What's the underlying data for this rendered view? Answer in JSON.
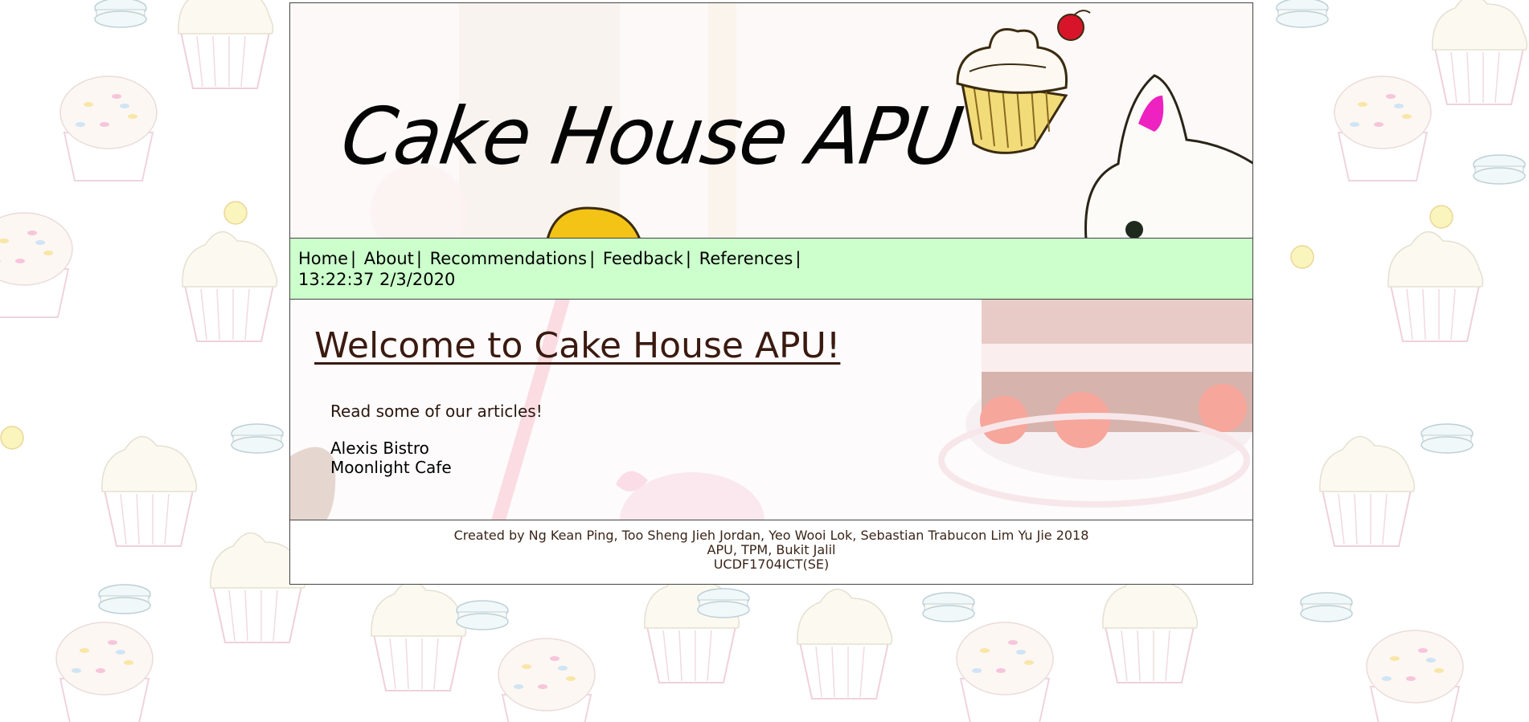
{
  "header": {
    "title": "Cake House APU"
  },
  "nav": {
    "items": [
      {
        "label": "Home"
      },
      {
        "label": "About"
      },
      {
        "label": "Recommendations"
      },
      {
        "label": "Feedback"
      },
      {
        "label": "References"
      }
    ],
    "separator": "|",
    "clock": "13:22:37 2/3/2020"
  },
  "main": {
    "heading": "Welcome to Cake House APU!",
    "intro": "Read some of our articles!",
    "articles": [
      {
        "label": "Alexis Bistro"
      },
      {
        "label": "Moonlight Cafe"
      }
    ]
  },
  "footer": {
    "line1": "Created by Ng Kean Ping, Too Sheng Jieh Jordan, Yeo Wooi Lok, Sebastian Trabucon Lim Yu Jie 2018",
    "line2": "APU, TPM, Bukit Jalil",
    "line3": "UCDF1704ICT(SE)"
  },
  "colors": {
    "nav_background": "#ccffcc",
    "heading": "#3a1a10",
    "border": "#444444"
  },
  "icons": {
    "background": "cupcake-pattern",
    "header_art": "cupcake-with-cherry-and-cat",
    "main_art": "layer-cake-with-cherries"
  }
}
